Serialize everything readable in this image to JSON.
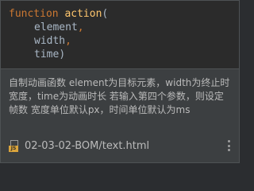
{
  "signature": {
    "keyword": "function",
    "name": "action",
    "open_paren": "(",
    "params": [
      "element",
      "width",
      "time"
    ],
    "comma": ",",
    "close_paren": ")"
  },
  "description": "自制动画函数 element为目标元素，width为终止时宽度，time为动画时长 若输入第四个参数，则设定帧数 宽度单位默认px，时间单位默认为ms",
  "footer": {
    "file_path": "02-03-02-BOM/text.html",
    "file_icon": "javascript-file-icon",
    "badge_text": "JS",
    "more_icon": "more-vertical-icon"
  },
  "colors": {
    "keyword": "#cc7832",
    "function_name": "#ffc66d",
    "text": "#a9b7c6",
    "background": "#3c3f41",
    "code_background": "#2b2b2b"
  }
}
